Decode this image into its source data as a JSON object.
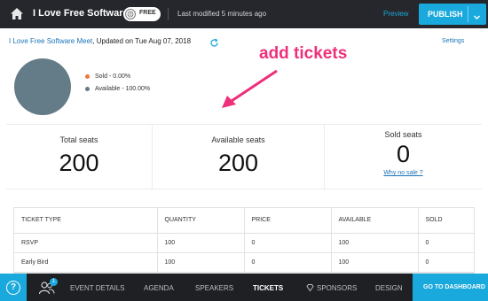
{
  "header": {
    "event_title": "I Love Free Software ...",
    "free_label": "FREE",
    "last_modified": "Last modified 5 minutes ago",
    "preview_label": "Preview",
    "publish_label": "PUBLISH"
  },
  "event_info": {
    "name": "I Love Free Software Meet",
    "updated": ", Updated on Tue Aug 07, 2018",
    "settings_label": "Settings"
  },
  "chart_data": {
    "type": "pie",
    "slices": [
      {
        "label": "Sold - 0.00%",
        "value": 0,
        "color": "#f0783c"
      },
      {
        "label": "Available - 100.00%",
        "value": 100,
        "color": "#647c88"
      }
    ]
  },
  "annotation": {
    "text": "add tickets",
    "color": "#ee2f7a"
  },
  "stats": {
    "total_seats": {
      "label": "Total seats",
      "value": "200"
    },
    "available_seats": {
      "label": "Available seats",
      "value": "200"
    },
    "sold_seats": {
      "label": "Sold seats",
      "value": "0",
      "link": "Why no sale ?"
    }
  },
  "tickets_table": {
    "headers": [
      "TICKET TYPE",
      "QUANTITY",
      "PRICE",
      "AVAILABLE",
      "SOLD"
    ],
    "rows": [
      [
        "RSVP",
        "100",
        "0",
        "100",
        "0"
      ],
      [
        "Early Bird",
        "100",
        "0",
        "100",
        "0"
      ]
    ]
  },
  "bottom_nav": {
    "help": "?",
    "notification_count": "1",
    "items": [
      "EVENT DETAILS",
      "AGENDA",
      "SPEAKERS",
      "TICKETS",
      "SPONSORS",
      "DESIGN"
    ],
    "active": "TICKETS",
    "dashboard_label": "GO TO DASHBOARD"
  },
  "colors": {
    "accent": "#1aa9dc",
    "topbar": "#25272c",
    "bottombar": "#1e2024"
  }
}
